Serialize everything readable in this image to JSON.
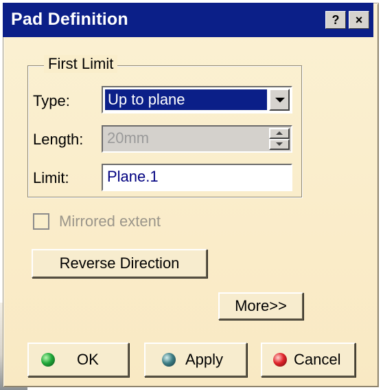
{
  "window": {
    "title": "Pad Definition",
    "help_button": "?",
    "close_button": "×"
  },
  "first_limit": {
    "legend": "First Limit",
    "type_label": "Type:",
    "type_value": "Up to plane",
    "length_label": "Length:",
    "length_value": "20mm",
    "length_enabled": false,
    "limit_label": "Limit:",
    "limit_value": "Plane.1"
  },
  "mirrored_extent": {
    "label": "Mirrored extent",
    "checked": false,
    "enabled": false
  },
  "buttons": {
    "reverse_direction": "Reverse Direction",
    "more": "More>>",
    "ok": "OK",
    "apply": "Apply",
    "cancel": "Cancel"
  },
  "colors": {
    "title_bar": "#0b1f88",
    "dialog_bg": "#faeecb",
    "ok_led": "green",
    "apply_led": "teal",
    "cancel_led": "red"
  }
}
